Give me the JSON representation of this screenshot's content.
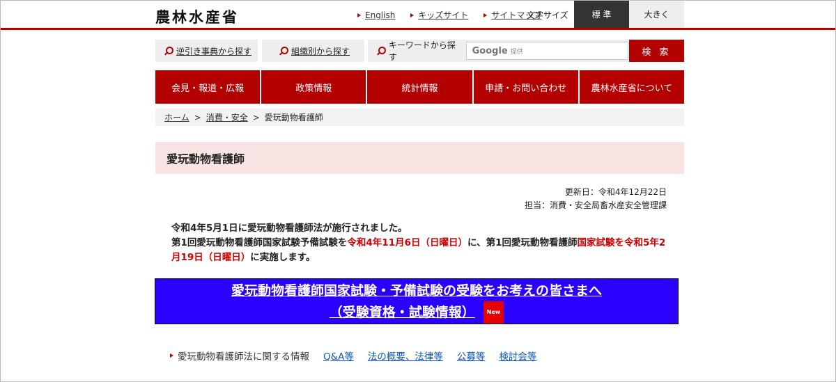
{
  "header": {
    "logo": "農林水産省",
    "links": [
      "English",
      "キッズサイト",
      "サイトマップ"
    ],
    "font_size_label": "文字サイズ",
    "font_size_standard": "標 準",
    "font_size_large": "大きく"
  },
  "search": {
    "reverse_lookup": "逆引き事典から探す",
    "by_org": "組織別から探す",
    "keyword_label": "キーワードから探す",
    "google_word": "Google",
    "google_sub": "提供",
    "button": "検 索"
  },
  "nav": [
    "会見・報道・広報",
    "政策情報",
    "統計情報",
    "申請・お問い合わせ",
    "農林水産省について"
  ],
  "breadcrumb": {
    "home": "ホーム",
    "sep": ">",
    "parent": "消費・安全",
    "current": "愛玩動物看護師"
  },
  "page_title": "愛玩動物看護師",
  "meta": {
    "updated": "更新日：令和4年12月22日",
    "charge": "担当：消費・安全局畜水産安全管理課"
  },
  "body": {
    "line1": "令和4年5月1日に愛玩動物看護師法が施行されました。",
    "l2_a": "第1回愛玩動物看護師国家試験予備試験を",
    "l2_red1": "令和4年11月6日（日曜日）",
    "l2_b": "に、第1回愛玩動物看護師",
    "l2_red2": "国家試験を令和5年2月19日（日曜日）",
    "l2_c": "に実施します。"
  },
  "banner": {
    "line1": "愛玩動物看護師国家試験・予備試験の受験をお考えの皆さまへ",
    "line2": "（受験資格・試験情報）",
    "badge": "New"
  },
  "info": {
    "label": "愛玩動物看護師法に関する情報",
    "links": [
      "Q&A等",
      "法の概要、法律等",
      "公募等",
      "検討会等"
    ]
  },
  "colors": {
    "brand_red": "#b30000",
    "banner_blue": "#2a00ff",
    "link_blue": "#0b57b8"
  }
}
